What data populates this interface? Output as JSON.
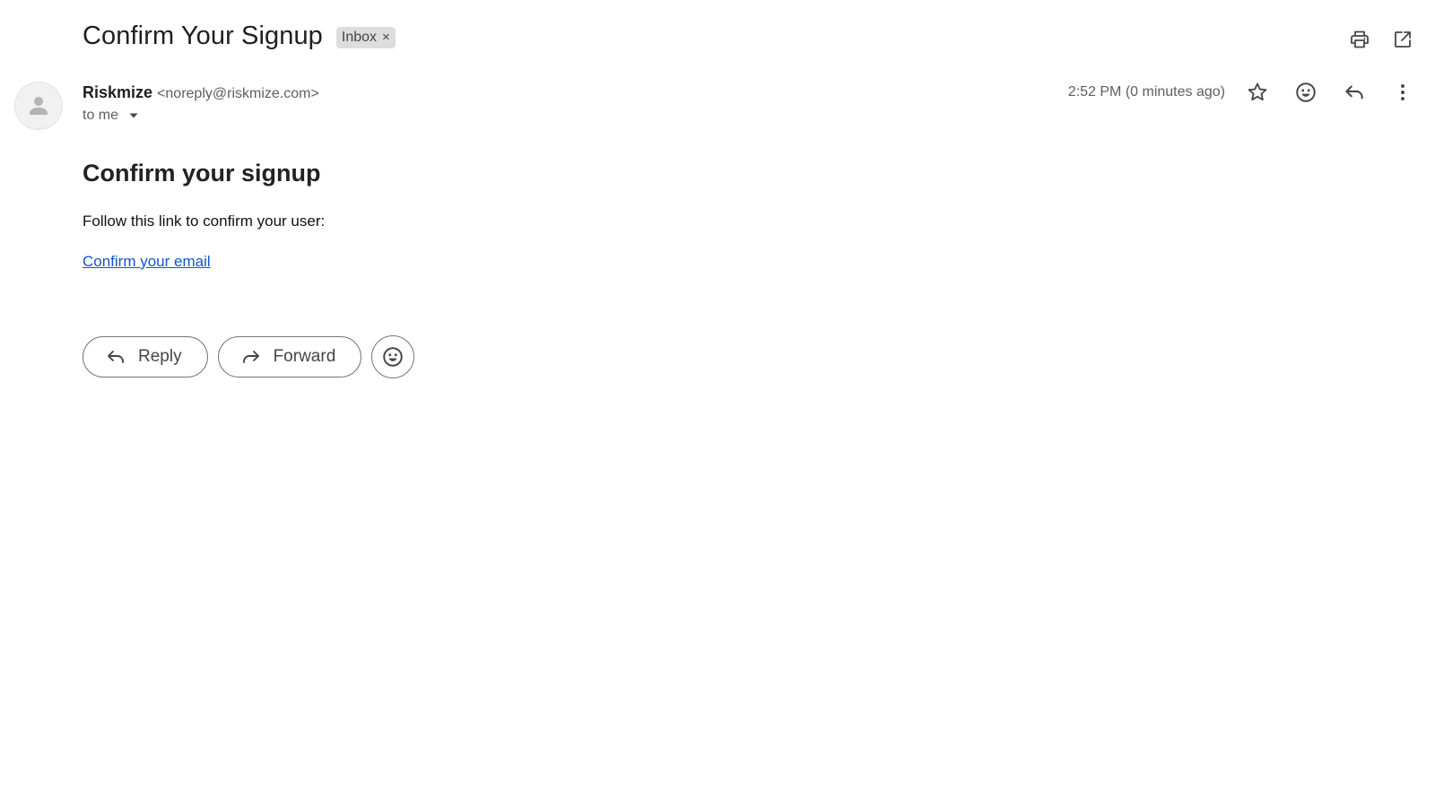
{
  "header": {
    "subject": "Confirm Your Signup",
    "label_chip": "Inbox",
    "label_chip_close": "×",
    "print_icon": "printer-icon",
    "open_new_window_icon": "open-in-new-icon"
  },
  "sender": {
    "name": "Riskmize",
    "email": "<noreply@riskmize.com>",
    "to": "to me",
    "timestamp": "2:52 PM (0 minutes ago)",
    "avatar_icon": "person-icon"
  },
  "message": {
    "heading": "Confirm your signup",
    "text": "Follow this link to confirm your user:",
    "link_text": "Confirm your email"
  },
  "actions": {
    "reply_label": "Reply",
    "forward_label": "Forward"
  },
  "colors": {
    "link": "#1155cc",
    "chip_bg": "#dddddd",
    "icon": "#444746"
  }
}
